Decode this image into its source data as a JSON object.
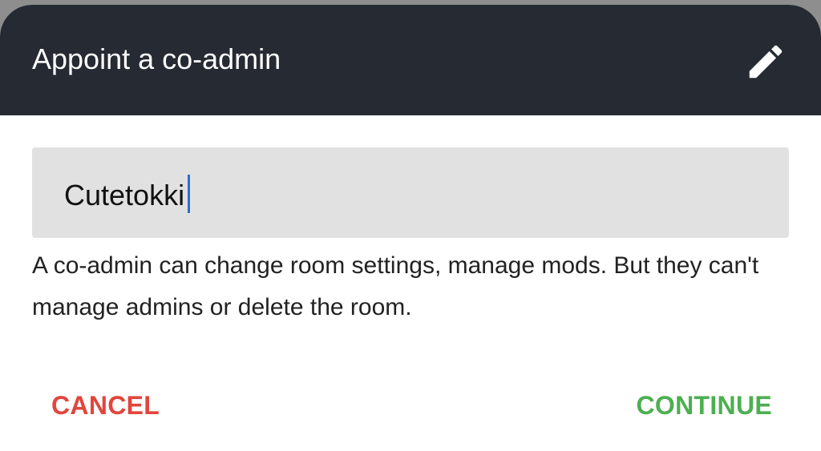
{
  "dialog": {
    "title": "Appoint a co-admin",
    "input": {
      "value": "Cutetokki"
    },
    "help_text": "A co-admin can change room settings, manage mods. But they can't manage admins or delete the room.",
    "buttons": {
      "cancel": "CANCEL",
      "continue": "CONTINUE"
    },
    "icons": {
      "header_action": "edit-pencil-icon"
    },
    "colors": {
      "header_bg": "#252a33",
      "cancel": "#e2453c",
      "continue": "#4caf50",
      "caret": "#2a6dd0"
    }
  }
}
